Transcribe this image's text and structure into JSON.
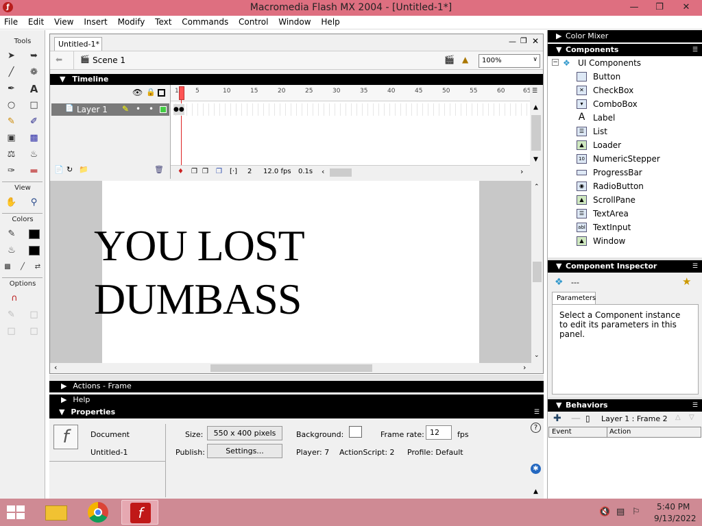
{
  "titlebar": {
    "title": "Macromedia Flash MX 2004 - [Untitled-1*]",
    "icon": "flash-app-icon"
  },
  "menubar": {
    "items": [
      "File",
      "Edit",
      "View",
      "Insert",
      "Modify",
      "Text",
      "Commands",
      "Control",
      "Window",
      "Help"
    ]
  },
  "toolbox": {
    "tools_label": "Tools",
    "view_label": "View",
    "colors_label": "Colors",
    "options_label": "Options"
  },
  "document": {
    "tab": "Untitled-1*",
    "scene": "Scene 1",
    "zoom": "100%"
  },
  "timeline": {
    "header": "Timeline",
    "layer_name": "Layer 1",
    "ruler": [
      "1",
      "5",
      "10",
      "15",
      "20",
      "25",
      "30",
      "35",
      "40",
      "45",
      "50",
      "55",
      "60",
      "65"
    ],
    "current_frame": "2",
    "fps": "12.0 fps",
    "elapsed": "0.1s"
  },
  "stage": {
    "line1": "YOU LOST",
    "line2": "DUMBASS"
  },
  "panels": {
    "actions": "Actions - Frame",
    "help": "Help",
    "properties": "Properties"
  },
  "properties": {
    "type": "Document",
    "name": "Untitled-1",
    "size_label": "Size:",
    "size_value": "550 x 400 pixels",
    "publish_label": "Publish:",
    "settings_button": "Settings...",
    "background_label": "Background:",
    "frame_rate_label": "Frame rate:",
    "frame_rate_value": "12",
    "fps_unit": "fps",
    "player": "Player: 7",
    "actionscript": "ActionScript: 2",
    "profile": "Profile: Default"
  },
  "right": {
    "color_mixer": "Color Mixer",
    "components": "Components",
    "ui_components": "UI Components",
    "component_items": [
      "Button",
      "CheckBox",
      "ComboBox",
      "Label",
      "List",
      "Loader",
      "NumericStepper",
      "ProgressBar",
      "RadioButton",
      "ScrollPane",
      "TextArea",
      "TextInput",
      "Window"
    ],
    "inspector": "Component Inspector",
    "inspector_dash": "---",
    "parameters_tab": "Parameters",
    "inspector_msg": "Select a Component instance to edit its parameters in this panel.",
    "behaviors": "Behaviors",
    "behaviors_frame": "Layer 1 : Frame 2",
    "event_col": "Event",
    "action_col": "Action"
  },
  "taskbar": {
    "time": "5:40 PM",
    "date": "9/13/2022"
  }
}
